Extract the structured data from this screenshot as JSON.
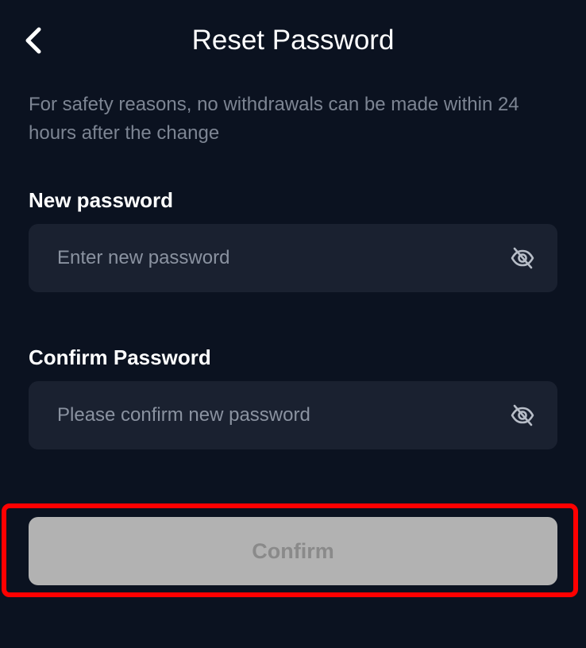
{
  "header": {
    "title": "Reset Password",
    "back_icon": "chevron-left-icon"
  },
  "notice": {
    "text": "For safety reasons, no withdrawals can be made within 24 hours after the change"
  },
  "new_password": {
    "label": "New password",
    "placeholder": "Enter new password",
    "value": "",
    "visibility_icon": "eye-off-icon"
  },
  "confirm_password": {
    "label": "Confirm Password",
    "placeholder": "Please confirm new password",
    "value": "",
    "visibility_icon": "eye-off-icon"
  },
  "actions": {
    "confirm_label": "Confirm",
    "confirm_enabled": false
  },
  "colors": {
    "background": "#0b1220",
    "field_background": "#1a2130",
    "muted_text": "#7d8593",
    "button_disabled": "#b2b2b2",
    "highlight": "#ff0000"
  }
}
